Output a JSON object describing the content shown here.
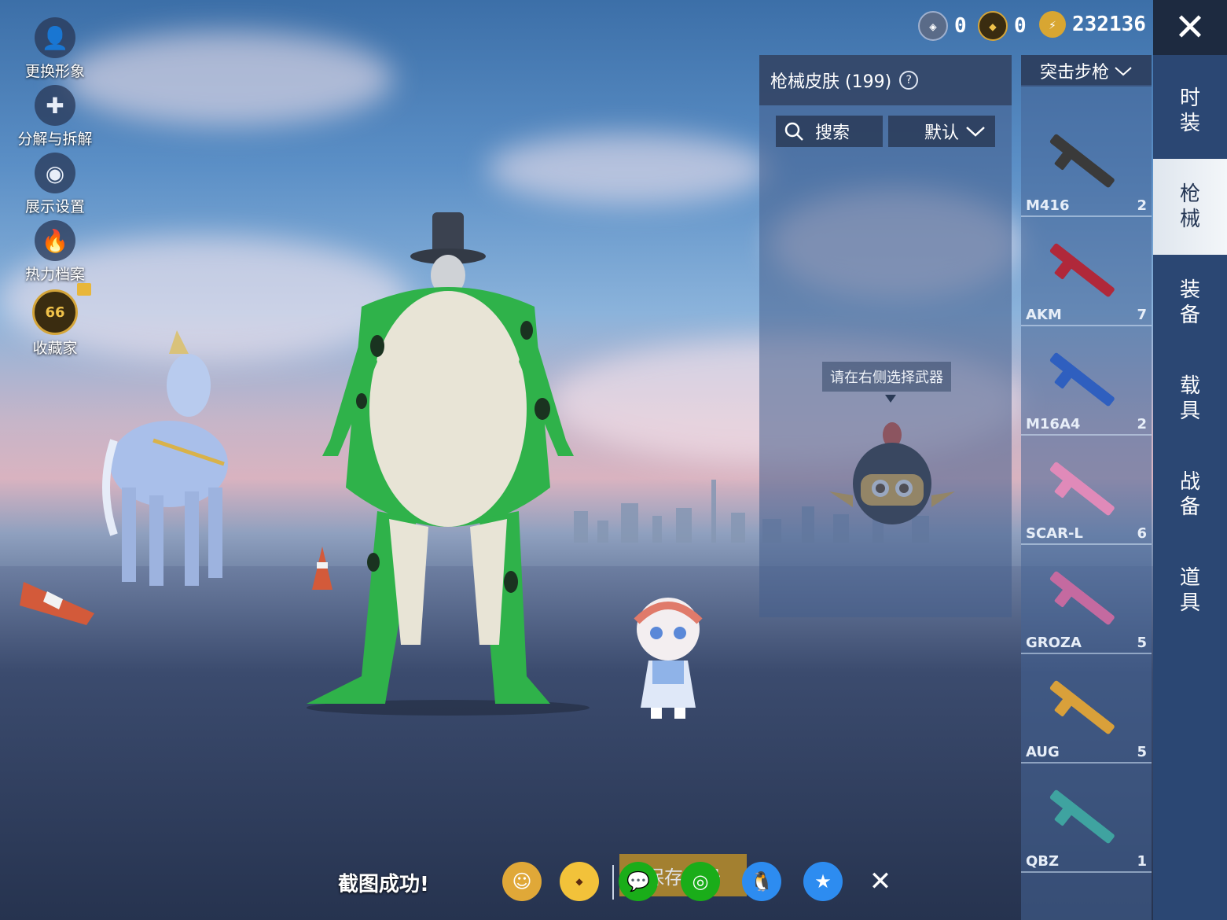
{
  "top_bar": {
    "currency_a": "0",
    "currency_b": "0",
    "currency_c": "232136",
    "close_label": "✕"
  },
  "left_menu": {
    "change_look": "更换形象",
    "decompose": "分解与拆解",
    "display_settings": "展示设置",
    "heat_archive": "热力档案",
    "collector": "收藏家",
    "collector_level": "66"
  },
  "skin_panel": {
    "title": "枪械皮肤 (199)",
    "help": "?",
    "search_label": "搜索",
    "sort_label": "默认",
    "hint": "请在右侧选择武器"
  },
  "category": {
    "selected": "突击步枪"
  },
  "weapons": [
    {
      "name": "M416",
      "count": "2",
      "color": "#3a3a3a"
    },
    {
      "name": "AKM",
      "count": "7",
      "color": "#b0283a"
    },
    {
      "name": "M16A4",
      "count": "2",
      "color": "#2f5fbf"
    },
    {
      "name": "SCAR-L",
      "count": "6",
      "color": "#e08ab9"
    },
    {
      "name": "GROZA",
      "count": "5",
      "color": "#c46aa0"
    },
    {
      "name": "AUG",
      "count": "5",
      "color": "#d9a03a"
    },
    {
      "name": "QBZ",
      "count": "1",
      "color": "#3fa3a0"
    }
  ],
  "right_tabs": {
    "fashion": "时\n装",
    "guns": "枪\n械",
    "equipment": "装\n备",
    "vehicles": "载\n具",
    "battle_prep": "战\n备",
    "items": "道\n具"
  },
  "bottom_bar": {
    "toast": "截图成功!",
    "save_label": "保存相册"
  },
  "colors": {
    "panel": "#2b4773",
    "accent_gold": "#b98d2a",
    "wechat": "#1aad19",
    "qq": "#2d8cf0"
  }
}
